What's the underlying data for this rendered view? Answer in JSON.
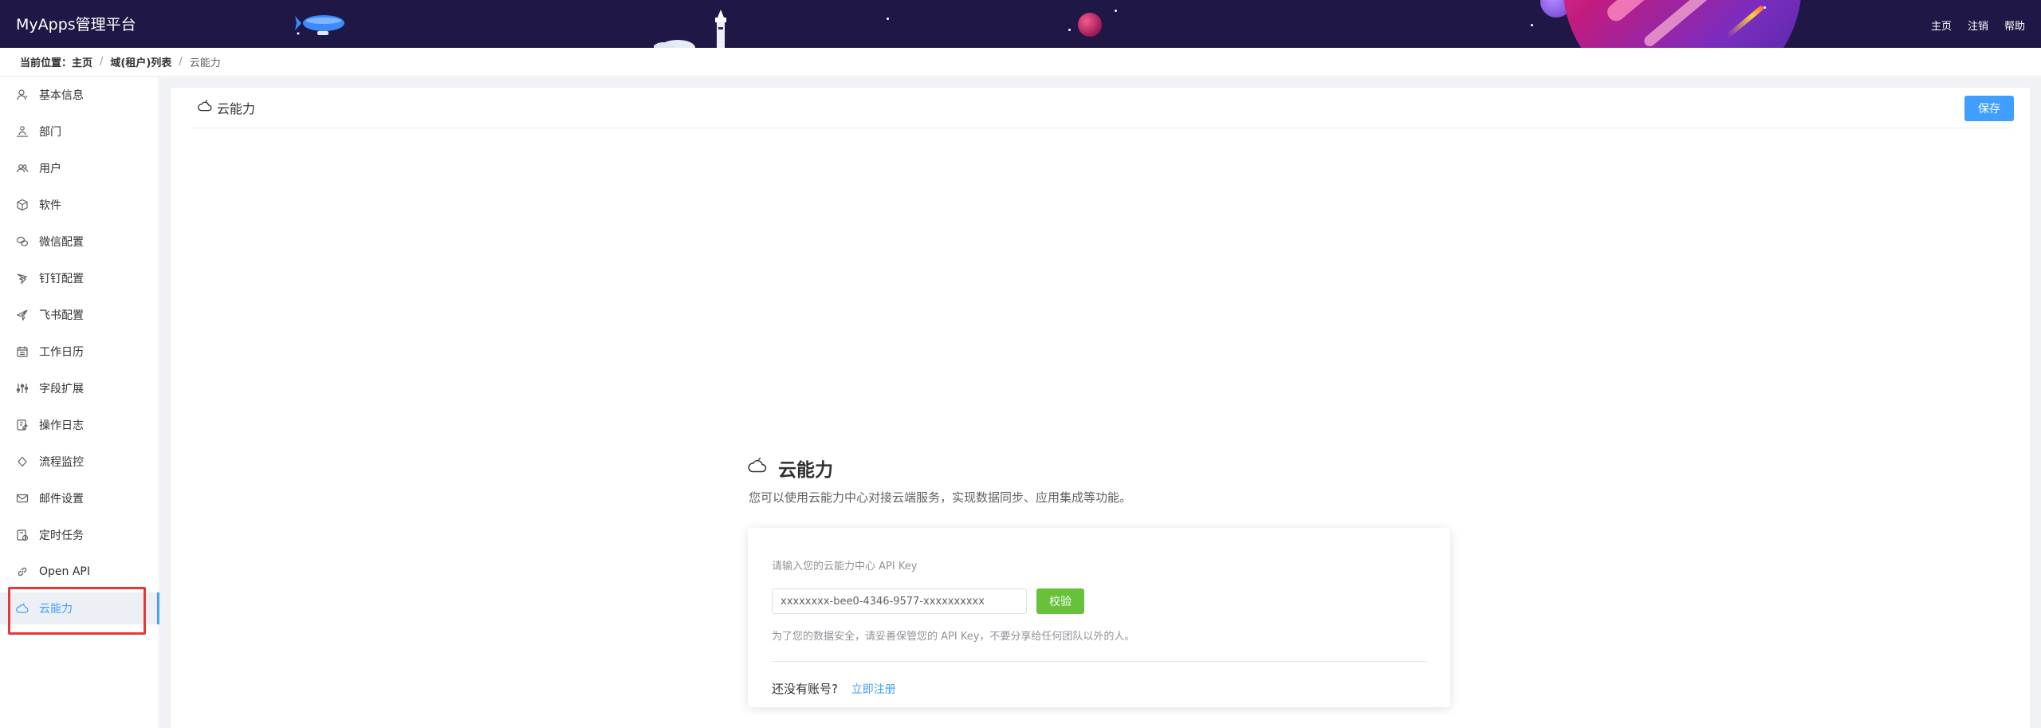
{
  "header": {
    "app_title": "MyApps管理平台",
    "nav": [
      "主页",
      "注销",
      "帮助"
    ],
    "colors": {
      "background": "#1f1846"
    }
  },
  "breadcrumb": {
    "label": "当前位置：",
    "items": [
      "主页",
      "域(租户)列表",
      "云能力"
    ],
    "separator": "/"
  },
  "sidebar": {
    "active_index": 14,
    "items": [
      {
        "label": "基本信息",
        "icon": "user-icon"
      },
      {
        "label": "部门",
        "icon": "org-chart-icon"
      },
      {
        "label": "用户",
        "icon": "users-icon"
      },
      {
        "label": "软件",
        "icon": "cube-icon"
      },
      {
        "label": "微信配置",
        "icon": "wechat-icon"
      },
      {
        "label": "钉钉配置",
        "icon": "dingtalk-icon"
      },
      {
        "label": "飞书配置",
        "icon": "paper-plane-icon"
      },
      {
        "label": "工作日历",
        "icon": "calendar-icon"
      },
      {
        "label": "字段扩展",
        "icon": "sliders-icon"
      },
      {
        "label": "操作日志",
        "icon": "edit-log-icon"
      },
      {
        "label": "流程监控",
        "icon": "diamond-icon"
      },
      {
        "label": "邮件设置",
        "icon": "mail-icon"
      },
      {
        "label": "定时任务",
        "icon": "schedule-icon"
      },
      {
        "label": "Open API",
        "icon": "link-icon"
      },
      {
        "label": "云能力",
        "icon": "cloud-icon"
      }
    ],
    "colors": {
      "active": "#409eff"
    }
  },
  "main": {
    "card_title": "云能力",
    "save_label": "保存",
    "cloud": {
      "title": "云能力",
      "description": "您可以使用云能力中心对接云端服务，实现数据同步、应用集成等功能。",
      "key_label": "请输入您的云能力中心 API Key",
      "key_value": "xxxxxxxx-bee0-4346-9577-xxxxxxxxxx",
      "verify_label": "校验",
      "note": "为了您的数据安全，请妥善保管您的 API Key，不要分享给任何团队以外的人。",
      "no_account_text": "还没有账号?",
      "register_label": "立即注册"
    },
    "colors": {
      "primary": "#409eff",
      "success": "#67c23a"
    }
  }
}
